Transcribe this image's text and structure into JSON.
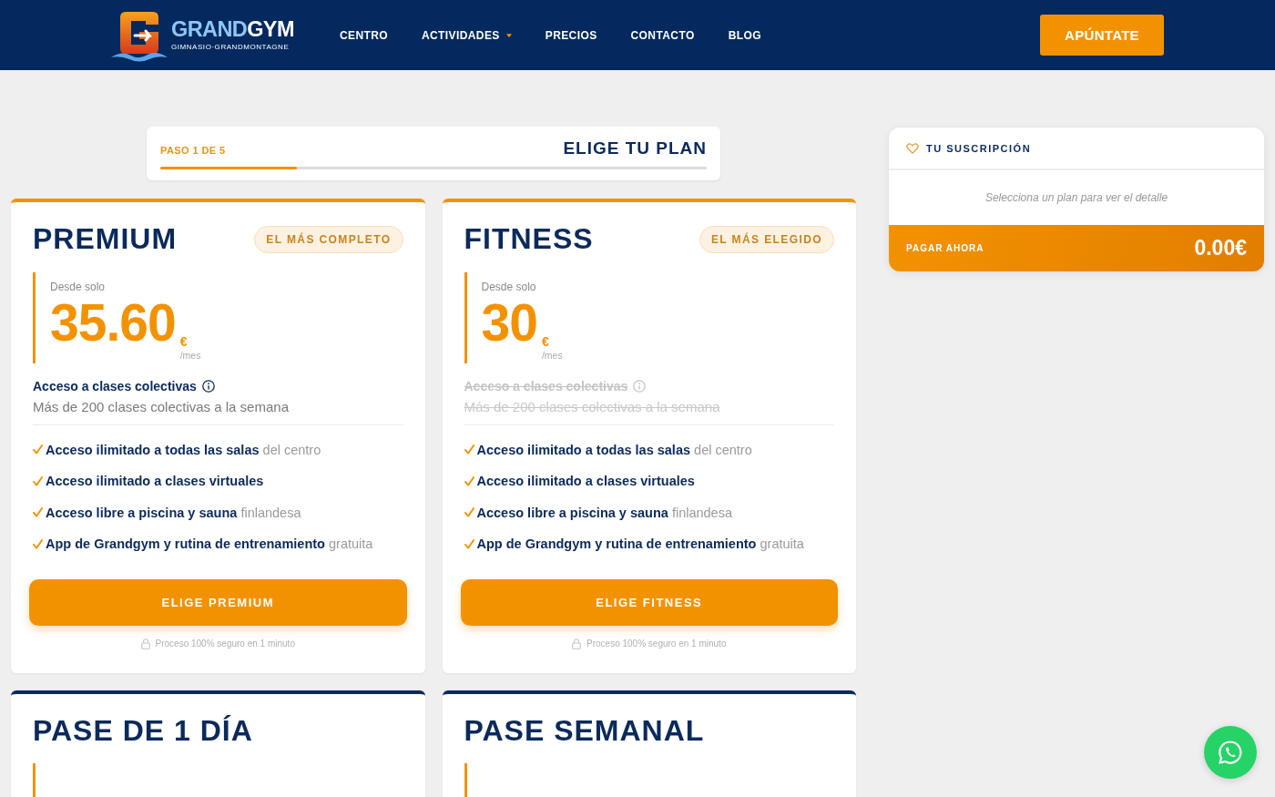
{
  "header": {
    "brand": {
      "name_first": "GRAND",
      "name_second": "GYM",
      "tagline": "GIMNASIO·GRANDMONTAGNE"
    },
    "nav": [
      {
        "label": "CENTRO",
        "has_dropdown": false
      },
      {
        "label": "ACTIVIDADES",
        "has_dropdown": true
      },
      {
        "label": "PRECIOS",
        "has_dropdown": false
      },
      {
        "label": "CONTACTO",
        "has_dropdown": false
      },
      {
        "label": "BLOG",
        "has_dropdown": false
      }
    ],
    "cta": "APÚNTATE"
  },
  "steps": {
    "label": "PASO 1 DE 5",
    "title": "ELIGE TU PLAN",
    "level": 0.25
  },
  "plans": [
    {
      "name": "PREMIUM",
      "featured": true,
      "badge": "EL MÁS COMPLETO",
      "price_prefix": "Desde solo",
      "price": "35.60",
      "currency": "€",
      "period": "/mes",
      "collective": {
        "title": "Acceso a clases colectivas",
        "description": "Más de 200 clases colectivas a la semana",
        "included": true
      },
      "features": [
        {
          "main": "Acceso ilimitado a todas las salas",
          "extra": "del centro"
        },
        {
          "main": "Acceso ilimitado a clases virtuales"
        },
        {
          "main": "Acceso libre a piscina y sauna",
          "extra": "finlandesa"
        },
        {
          "main": "App de Grandgym y rutina de entrenamiento",
          "extra": "gratuita"
        }
      ],
      "button": "ELIGE PREMIUM",
      "note": "Proceso 100% seguro en 1 minuto"
    },
    {
      "name": "FITNESS",
      "featured": true,
      "badge": "EL MÁS ELEGIDO",
      "price_prefix": "Desde solo",
      "price": "30",
      "currency": "€",
      "period": "/mes",
      "collective": {
        "title": "Acceso a clases colectivas",
        "description": "Más de 200 clases colectivas a la semana",
        "included": false
      },
      "features": [
        {
          "main": "Acceso ilimitado a todas las salas",
          "extra": "del centro"
        },
        {
          "main": "Acceso ilimitado a clases virtuales"
        },
        {
          "main": "Acceso libre a piscina y sauna",
          "extra": "finlandesa"
        },
        {
          "main": "App de Grandgym y rutina de entrenamiento",
          "extra": "gratuita"
        }
      ],
      "button": "ELIGE FITNESS",
      "note": "Proceso 100% seguro en 1 minuto"
    },
    {
      "name": "PASE DE 1 DÍA",
      "featured": false
    },
    {
      "name": "PASE SEMANAL",
      "featured": false
    }
  ],
  "summary": {
    "title": "TU SUSCRIPCIÓN",
    "empty_message": "Selecciona un plan para ver el detalle",
    "pay_label": "PAGAR AHORA",
    "total": "0.00€"
  }
}
